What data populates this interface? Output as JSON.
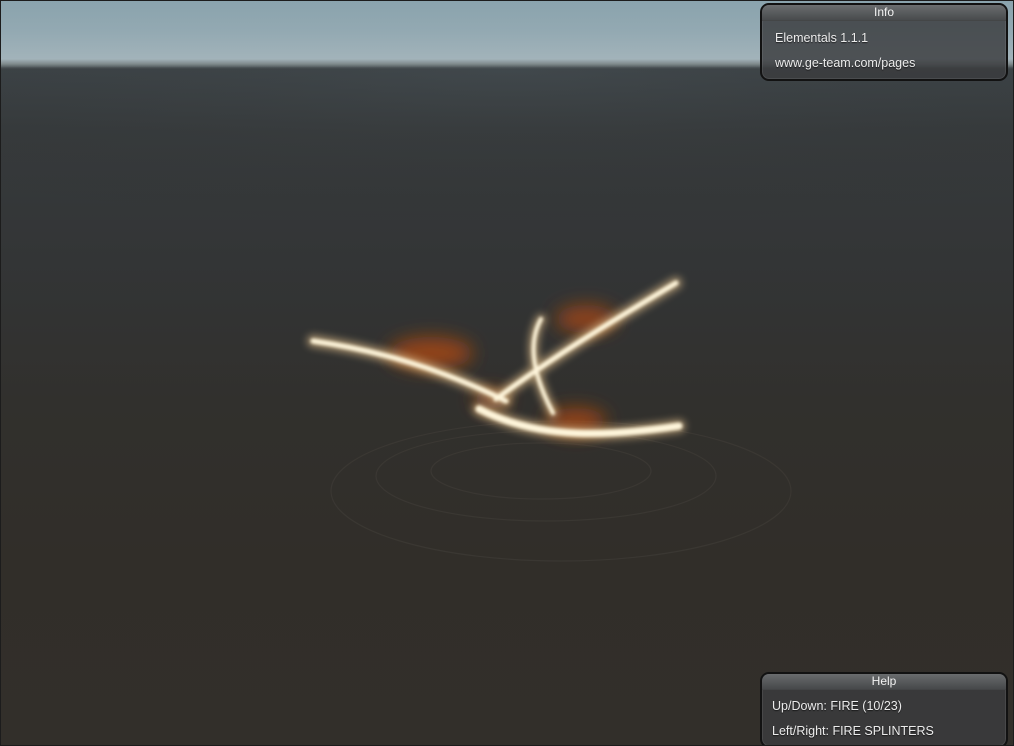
{
  "info_panel": {
    "title": "Info",
    "version": "Elementals 1.1.1",
    "website": "www.ge-team.com/pages"
  },
  "help_panel": {
    "title": "Help",
    "up_down": "Up/Down: FIRE (10/23)",
    "left_right": "Left/Right: FIRE SPLINTERS"
  },
  "scene": {
    "effect_category": "FIRE",
    "effect_name": "FIRE SPLINTERS",
    "effect_index": 10,
    "effect_total": 23,
    "colors": {
      "sky": "#93a9b2",
      "ground": "#312e29",
      "flame_core": "#fff6dc",
      "flame_glow": "#ffd79a",
      "smoke": "#b34a14"
    }
  }
}
